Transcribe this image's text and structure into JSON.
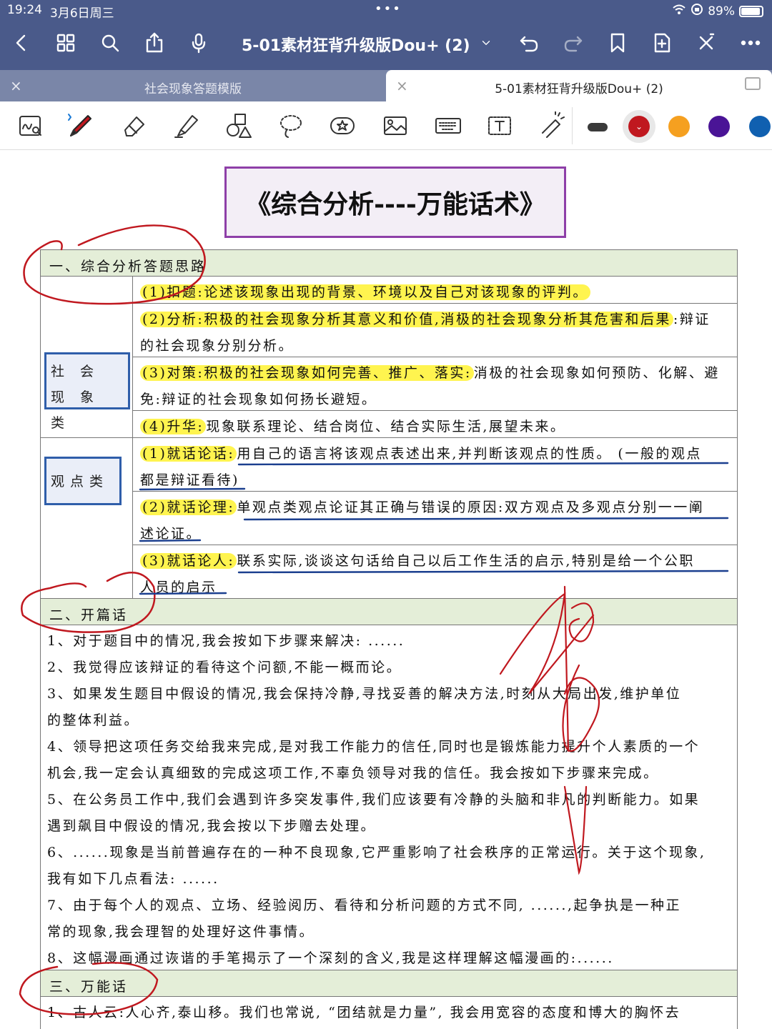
{
  "status": {
    "time": "19:24",
    "date": "3月6日周三",
    "battery": "89%"
  },
  "nav": {
    "title": "5-01素材狂背升级版Dou+ (2)",
    "icons": [
      "back-icon",
      "grid-icon",
      "search-icon",
      "share-icon",
      "mic-icon",
      "chevron-down-icon",
      "undo-icon",
      "redo-icon",
      "bookmark-icon",
      "add-page-icon",
      "close-icon",
      "more-icon"
    ]
  },
  "tabs": [
    {
      "label": "社会现象答题模版",
      "active": false
    },
    {
      "label": "5-01素材狂背升级版Dou+ (2)",
      "active": true
    }
  ],
  "toolbar": {
    "tools": [
      "handwriting-search-icon",
      "pen-icon",
      "eraser-icon",
      "highlighter-icon",
      "shapes-icon",
      "lasso-icon",
      "sticker-icon",
      "image-icon",
      "keyboard-icon",
      "text-icon",
      "laser-pointer-icon"
    ],
    "colors": [
      "#3a3a3a",
      "#c0181f",
      "#f5a020",
      "#4a1496",
      "#1060b0"
    ]
  },
  "doc": {
    "title": "《综合分析----万能话术》",
    "sec1": {
      "header": "一、综合分析答题思路",
      "cat1": "社 会 现 象 类",
      "cat2": "观点类",
      "r1": "(1)扣题:论述该现象出现的背景、环境以及自己对该现象的评判。",
      "r2a": "(2)分析:积极的社会现象分析其意义和价值,消极的社会现象分析其危害和后果",
      "r2b": ":辩证",
      "r2c": "的社会现象分别分析。",
      "r3a": "(3)对策:积极的社会现象如何完善、推广、落实:",
      "r3b": "消极的社会现象如何预防、化解、避",
      "r3c": "免:辩证的社会现象如何扬长避短。",
      "r4a": "(4)升华:",
      "r4b": "现象联系理论、结合岗位、结合实际生活,展望未来。",
      "r5a": "(1)就话论话:",
      "r5b": "用自己的语言将该观点表述出来,并判断该观点的性质。 (一般的观点",
      "r5c": "都是辩证看待)",
      "r6a": "(2)就话论理:",
      "r6b": "单观点类观点论证其正确与错误的原因:双方观点及多观点分别一一阐",
      "r6c": "述论证。",
      "r7a": "(3)就话论人:",
      "r7b": "联系实际,谈谈这句话给自己以后工作生活的启示,特别是给一个公职",
      "r7c": "人员的启示"
    },
    "sec2": {
      "header": "二、开篇话",
      "lines": [
        "1、对于题目中的情况,我会按如下步骤来解决: ......",
        "2、我觉得应该辩证的看待这个问额,不能一概而论。",
        "3、如果发生题目中假设的情况,我会保持冷静,寻找妥善的解决方法,时刻从大局出发,维护单位",
        "的整体利益。",
        "4、领导把这项任务交给我来完成,是对我工作能力的信任,同时也是锻炼能力提升个人素质的一个",
        "机会,我一定会认真细致的完成这项工作,不辜负领导对我的信任。我会按如下步骤来完成。",
        "5、在公务员工作中,我们会遇到许多突发事件,我们应该要有冷静的头脑和非凡的判断能力。如果",
        "遇到飙目中假设的情况,我会按以下步赠去处理。",
        "6、......现象是当前普遍存在的一种不良现象,它严重影响了社会秩序的正常运行。关于这个现象,",
        "我有如下几点看法: ......",
        "7、由于每个人的观点、立场、经验阅历、看待和分析问题的方式不同, ......,起争执是一种正",
        "常的现象,我会理智的处理好这件事情。",
        "8、这幅漫画通过诙谐的手笔揭示了一个深刻的含义,我是这样理解这幅漫画的:......"
      ]
    },
    "sec3": {
      "header": "三、万能话",
      "lines": [
        "1、古人云:人心齐,泰山移。我们也常说, “团结就是力量”, 我会用宽容的态度和博大的胸怀去"
      ]
    }
  }
}
